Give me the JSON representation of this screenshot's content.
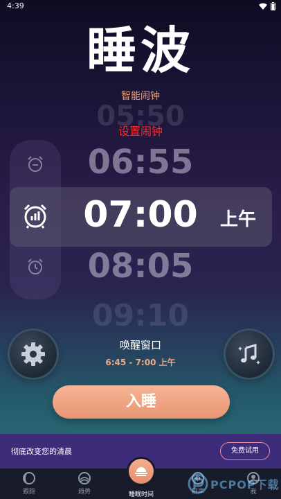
{
  "status_bar": {
    "time": "4:39"
  },
  "app": {
    "title": "睡波",
    "subtitle": "智能闹钟"
  },
  "picker": {
    "ghost_above": "05:50",
    "set_alarm_label": "设置闹钟",
    "before": "06:55",
    "selected": "07:00",
    "period": "上午",
    "after": "08:05",
    "ghost_below": "09:10"
  },
  "wake_window": {
    "label": "唤醒窗口",
    "range": "6:45 - 7:00 上午"
  },
  "actions": {
    "sleep_label": "入睡"
  },
  "promo": {
    "text": "彻底改变您的清晨",
    "trial_label": "免费试用"
  },
  "nav": {
    "items": [
      {
        "label": "跟踪",
        "icon": "moon-icon"
      },
      {
        "label": "趋势",
        "icon": "trend-icon"
      },
      {
        "label": "睡眠时间",
        "icon": "sunrise-icon",
        "active": true
      },
      {
        "label": "鼾声",
        "icon": "snore-icon"
      },
      {
        "label": "我",
        "icon": "profile-icon"
      }
    ]
  },
  "watermark": {
    "text": "PCPOP下载"
  },
  "colors": {
    "accent": "#e99572",
    "promo_bg": "#3d2c7a",
    "alert": "#ff2a2a"
  }
}
